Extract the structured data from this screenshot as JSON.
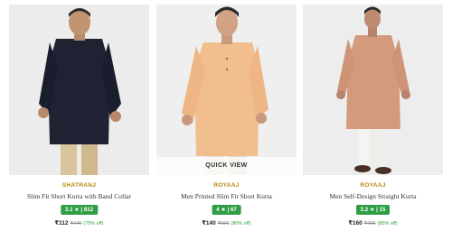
{
  "products": [
    {
      "brand": "SHATRANJ",
      "title": "Slim Fit Short Kurta with Band Collar",
      "rating_badge": "3.1 ★ | 812",
      "price": "₹112",
      "mrp": "₹449",
      "discount": "(75% off)",
      "quick_view_label": ""
    },
    {
      "brand": "ROYAAJ",
      "title": "Men Printed Slim Fit Short Kurta",
      "rating_badge": "4 ★ | 67",
      "price": "₹140",
      "mrp": "₹699",
      "discount": "(80% off)",
      "quick_view_label": "QUICK VIEW"
    },
    {
      "brand": "ROYAAJ",
      "title": "Men Self-Design Straight Kurta",
      "rating_badge": "3.2 ★ | 15",
      "price": "₹160",
      "mrp": "₹799",
      "discount": "(80% off)",
      "quick_view_label": ""
    }
  ],
  "colors": {
    "brand_text": "#b8860b",
    "rating_badge": "#2f9e44",
    "discount_text": "#2f9e44"
  }
}
